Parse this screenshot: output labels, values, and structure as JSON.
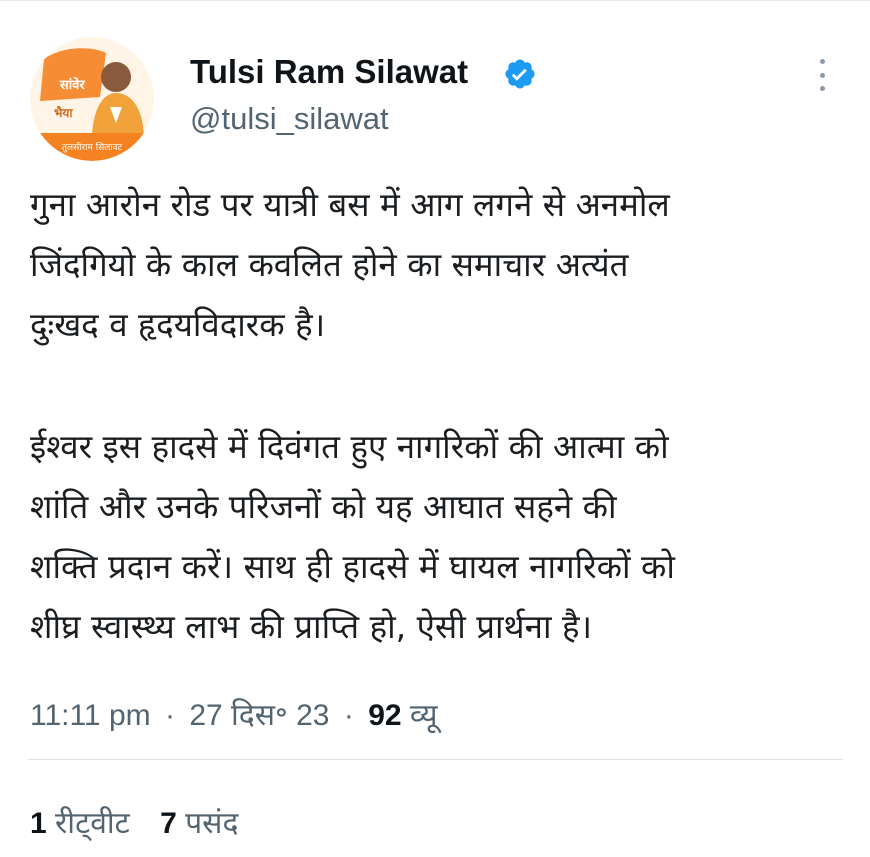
{
  "tweet": {
    "author": {
      "name": "Tulsi Ram Silawat",
      "handle": "@tulsi_silawat",
      "verified": true,
      "avatar": {
        "text_top": "सांवेर",
        "text_mid": "भैया",
        "text_banner": "तुलसीराम सिलावट"
      }
    },
    "text_paragraph_1": "गुना आरोन रोड पर यात्री बस में आग लगने से अनमोल\nजिंदगियो के काल कवलित होने का समाचार अत्यंत\nदुःखद व हृदयविदारक है।",
    "text_paragraph_2": "ईश्वर इस हादसे में दिवंगत हुए नागरिकों की आत्मा को\nशांति और उनके परिजनों को यह आघात सहने की\nशक्ति प्रदान करें। साथ ही हादसे में घायल नागरिकों को\nशीघ्र स्वास्थ्य लाभ की प्राप्ति हो, ऐसी प्रार्थना है।",
    "time": "11:11 pm",
    "date": "27 दिस॰ 23",
    "separator": "·",
    "views_count": "92",
    "views_label": "व्यू",
    "retweets_count": "1",
    "retweets_label": "रीट्वीट",
    "likes_count": "7",
    "likes_label": "पसंद"
  },
  "colors": {
    "verified_badge": "#1d9bf0",
    "secondary_text": "#536471",
    "primary_text": "#0f1419",
    "avatar_orange": "#f58220"
  },
  "icons": {
    "verified": "verified-badge-icon",
    "more": "more-vertical-icon"
  }
}
